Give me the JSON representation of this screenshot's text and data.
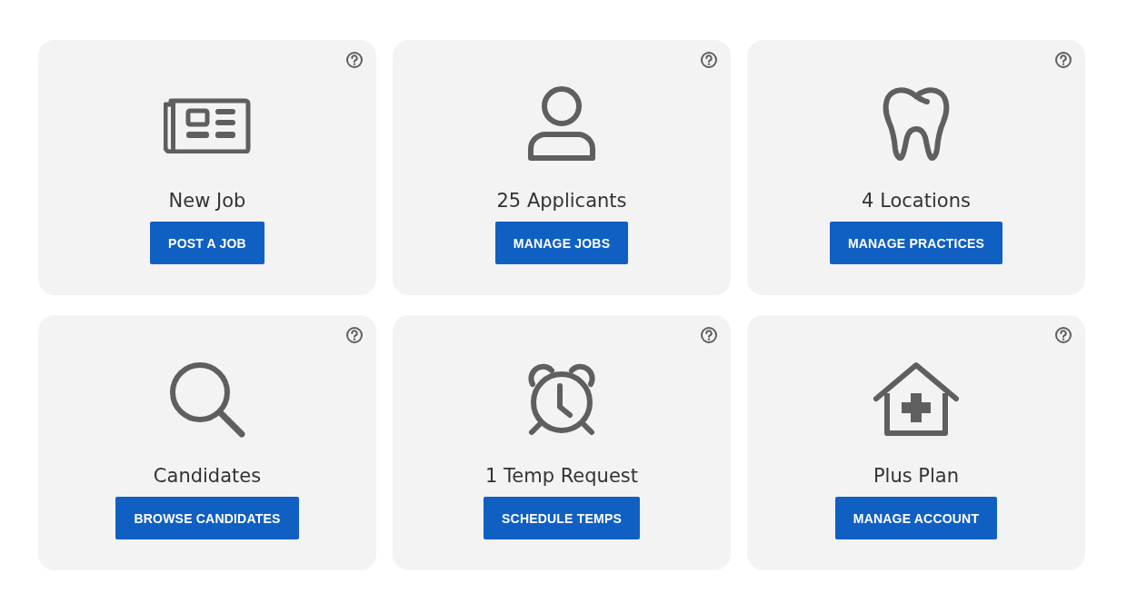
{
  "cards": [
    {
      "kind": "newspaper",
      "title": "New Job",
      "button": "POST A JOB"
    },
    {
      "kind": "person",
      "title": "25 Applicants",
      "button": "MANAGE JOBS"
    },
    {
      "kind": "tooth",
      "title": "4 Locations",
      "button": "MANAGE PRACTICES"
    },
    {
      "kind": "search",
      "title": "Candidates",
      "button": "BROWSE CANDIDATES"
    },
    {
      "kind": "alarm",
      "title": "1 Temp Request",
      "button": "SCHEDULE TEMPS"
    },
    {
      "kind": "house",
      "title": "Plus Plan",
      "button": "MANAGE ACCOUNT"
    }
  ]
}
